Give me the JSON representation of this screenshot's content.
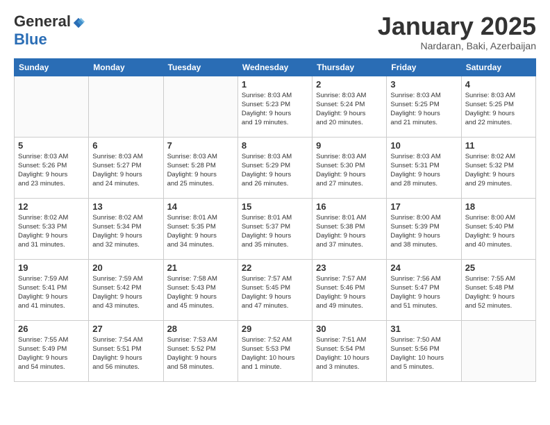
{
  "header": {
    "logo_general": "General",
    "logo_blue": "Blue",
    "month_title": "January 2025",
    "location": "Nardaran, Baki, Azerbaijan"
  },
  "days_of_week": [
    "Sunday",
    "Monday",
    "Tuesday",
    "Wednesday",
    "Thursday",
    "Friday",
    "Saturday"
  ],
  "weeks": [
    [
      {
        "day": "",
        "info": ""
      },
      {
        "day": "",
        "info": ""
      },
      {
        "day": "",
        "info": ""
      },
      {
        "day": "1",
        "info": "Sunrise: 8:03 AM\nSunset: 5:23 PM\nDaylight: 9 hours\nand 19 minutes."
      },
      {
        "day": "2",
        "info": "Sunrise: 8:03 AM\nSunset: 5:24 PM\nDaylight: 9 hours\nand 20 minutes."
      },
      {
        "day": "3",
        "info": "Sunrise: 8:03 AM\nSunset: 5:25 PM\nDaylight: 9 hours\nand 21 minutes."
      },
      {
        "day": "4",
        "info": "Sunrise: 8:03 AM\nSunset: 5:25 PM\nDaylight: 9 hours\nand 22 minutes."
      }
    ],
    [
      {
        "day": "5",
        "info": "Sunrise: 8:03 AM\nSunset: 5:26 PM\nDaylight: 9 hours\nand 23 minutes."
      },
      {
        "day": "6",
        "info": "Sunrise: 8:03 AM\nSunset: 5:27 PM\nDaylight: 9 hours\nand 24 minutes."
      },
      {
        "day": "7",
        "info": "Sunrise: 8:03 AM\nSunset: 5:28 PM\nDaylight: 9 hours\nand 25 minutes."
      },
      {
        "day": "8",
        "info": "Sunrise: 8:03 AM\nSunset: 5:29 PM\nDaylight: 9 hours\nand 26 minutes."
      },
      {
        "day": "9",
        "info": "Sunrise: 8:03 AM\nSunset: 5:30 PM\nDaylight: 9 hours\nand 27 minutes."
      },
      {
        "day": "10",
        "info": "Sunrise: 8:03 AM\nSunset: 5:31 PM\nDaylight: 9 hours\nand 28 minutes."
      },
      {
        "day": "11",
        "info": "Sunrise: 8:02 AM\nSunset: 5:32 PM\nDaylight: 9 hours\nand 29 minutes."
      }
    ],
    [
      {
        "day": "12",
        "info": "Sunrise: 8:02 AM\nSunset: 5:33 PM\nDaylight: 9 hours\nand 31 minutes."
      },
      {
        "day": "13",
        "info": "Sunrise: 8:02 AM\nSunset: 5:34 PM\nDaylight: 9 hours\nand 32 minutes."
      },
      {
        "day": "14",
        "info": "Sunrise: 8:01 AM\nSunset: 5:35 PM\nDaylight: 9 hours\nand 34 minutes."
      },
      {
        "day": "15",
        "info": "Sunrise: 8:01 AM\nSunset: 5:37 PM\nDaylight: 9 hours\nand 35 minutes."
      },
      {
        "day": "16",
        "info": "Sunrise: 8:01 AM\nSunset: 5:38 PM\nDaylight: 9 hours\nand 37 minutes."
      },
      {
        "day": "17",
        "info": "Sunrise: 8:00 AM\nSunset: 5:39 PM\nDaylight: 9 hours\nand 38 minutes."
      },
      {
        "day": "18",
        "info": "Sunrise: 8:00 AM\nSunset: 5:40 PM\nDaylight: 9 hours\nand 40 minutes."
      }
    ],
    [
      {
        "day": "19",
        "info": "Sunrise: 7:59 AM\nSunset: 5:41 PM\nDaylight: 9 hours\nand 41 minutes."
      },
      {
        "day": "20",
        "info": "Sunrise: 7:59 AM\nSunset: 5:42 PM\nDaylight: 9 hours\nand 43 minutes."
      },
      {
        "day": "21",
        "info": "Sunrise: 7:58 AM\nSunset: 5:43 PM\nDaylight: 9 hours\nand 45 minutes."
      },
      {
        "day": "22",
        "info": "Sunrise: 7:57 AM\nSunset: 5:45 PM\nDaylight: 9 hours\nand 47 minutes."
      },
      {
        "day": "23",
        "info": "Sunrise: 7:57 AM\nSunset: 5:46 PM\nDaylight: 9 hours\nand 49 minutes."
      },
      {
        "day": "24",
        "info": "Sunrise: 7:56 AM\nSunset: 5:47 PM\nDaylight: 9 hours\nand 51 minutes."
      },
      {
        "day": "25",
        "info": "Sunrise: 7:55 AM\nSunset: 5:48 PM\nDaylight: 9 hours\nand 52 minutes."
      }
    ],
    [
      {
        "day": "26",
        "info": "Sunrise: 7:55 AM\nSunset: 5:49 PM\nDaylight: 9 hours\nand 54 minutes."
      },
      {
        "day": "27",
        "info": "Sunrise: 7:54 AM\nSunset: 5:51 PM\nDaylight: 9 hours\nand 56 minutes."
      },
      {
        "day": "28",
        "info": "Sunrise: 7:53 AM\nSunset: 5:52 PM\nDaylight: 9 hours\nand 58 minutes."
      },
      {
        "day": "29",
        "info": "Sunrise: 7:52 AM\nSunset: 5:53 PM\nDaylight: 10 hours\nand 1 minute."
      },
      {
        "day": "30",
        "info": "Sunrise: 7:51 AM\nSunset: 5:54 PM\nDaylight: 10 hours\nand 3 minutes."
      },
      {
        "day": "31",
        "info": "Sunrise: 7:50 AM\nSunset: 5:56 PM\nDaylight: 10 hours\nand 5 minutes."
      },
      {
        "day": "",
        "info": ""
      }
    ]
  ]
}
